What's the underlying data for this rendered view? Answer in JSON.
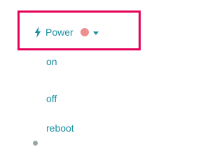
{
  "power_menu": {
    "icon": "lightning-bolt-icon",
    "label": "Power",
    "status_color": "#ee8f8f",
    "accent_color": "#1a8ea0",
    "highlight_color": "#e5005a",
    "items": [
      {
        "label": "on"
      },
      {
        "label": "off"
      },
      {
        "label": "reboot"
      }
    ]
  }
}
